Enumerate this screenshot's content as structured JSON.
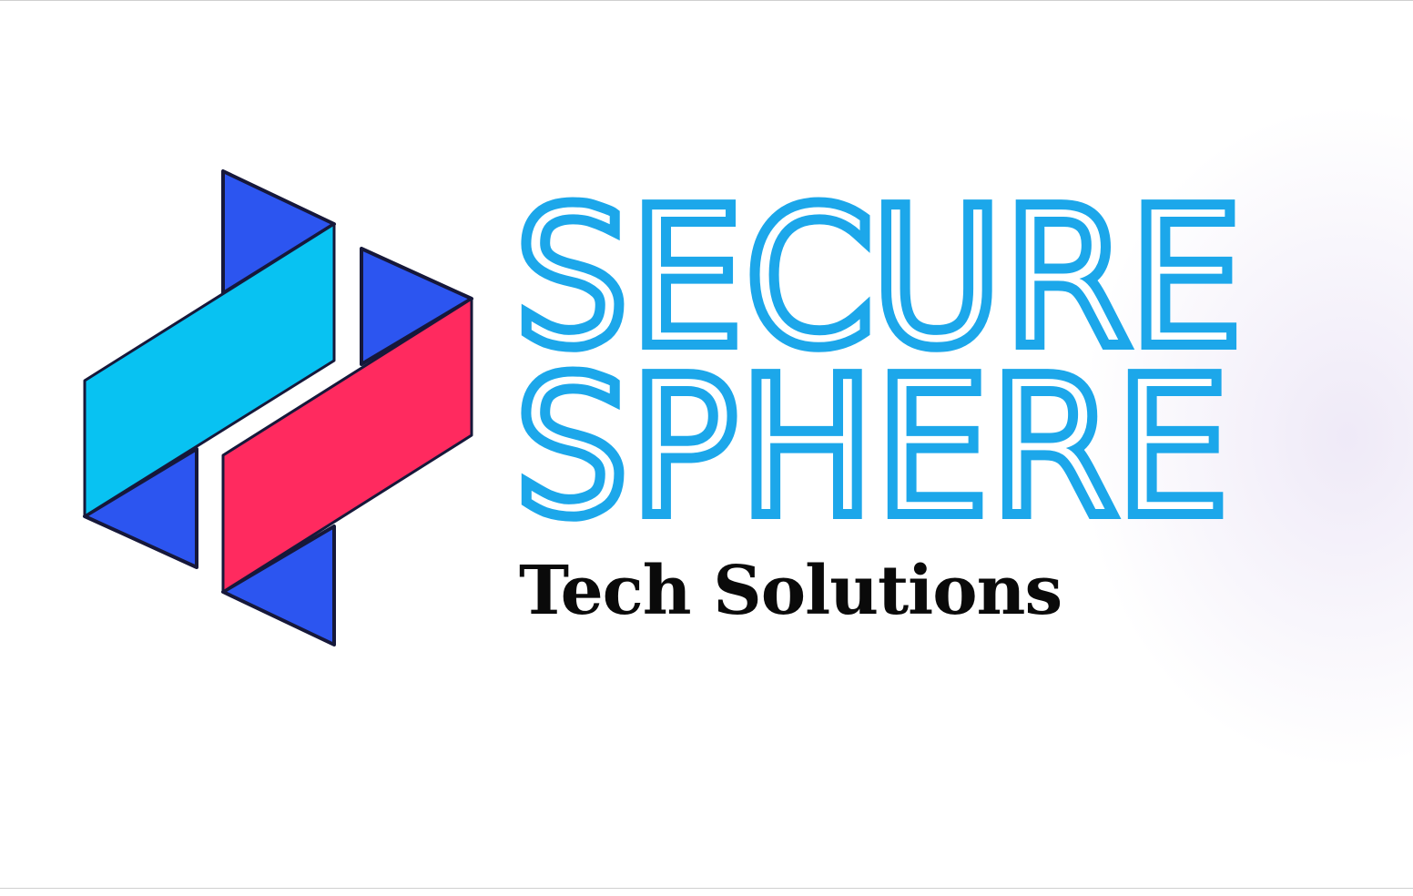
{
  "logo": {
    "brand_line_1": "SECURE",
    "brand_line_2": "SPHERE",
    "tagline": "Tech Solutions"
  },
  "colors": {
    "brand_blue_text": "#1ca7ea",
    "cyan_band": "#08c2f2",
    "red_band": "#ff2a5f",
    "dark_blue_triangle": "#2c55f0",
    "outline": "#16183a",
    "tagline_color": "#0a0a0a",
    "background": "#ffffff"
  },
  "icon": "securesphere-logo-mark-icon"
}
